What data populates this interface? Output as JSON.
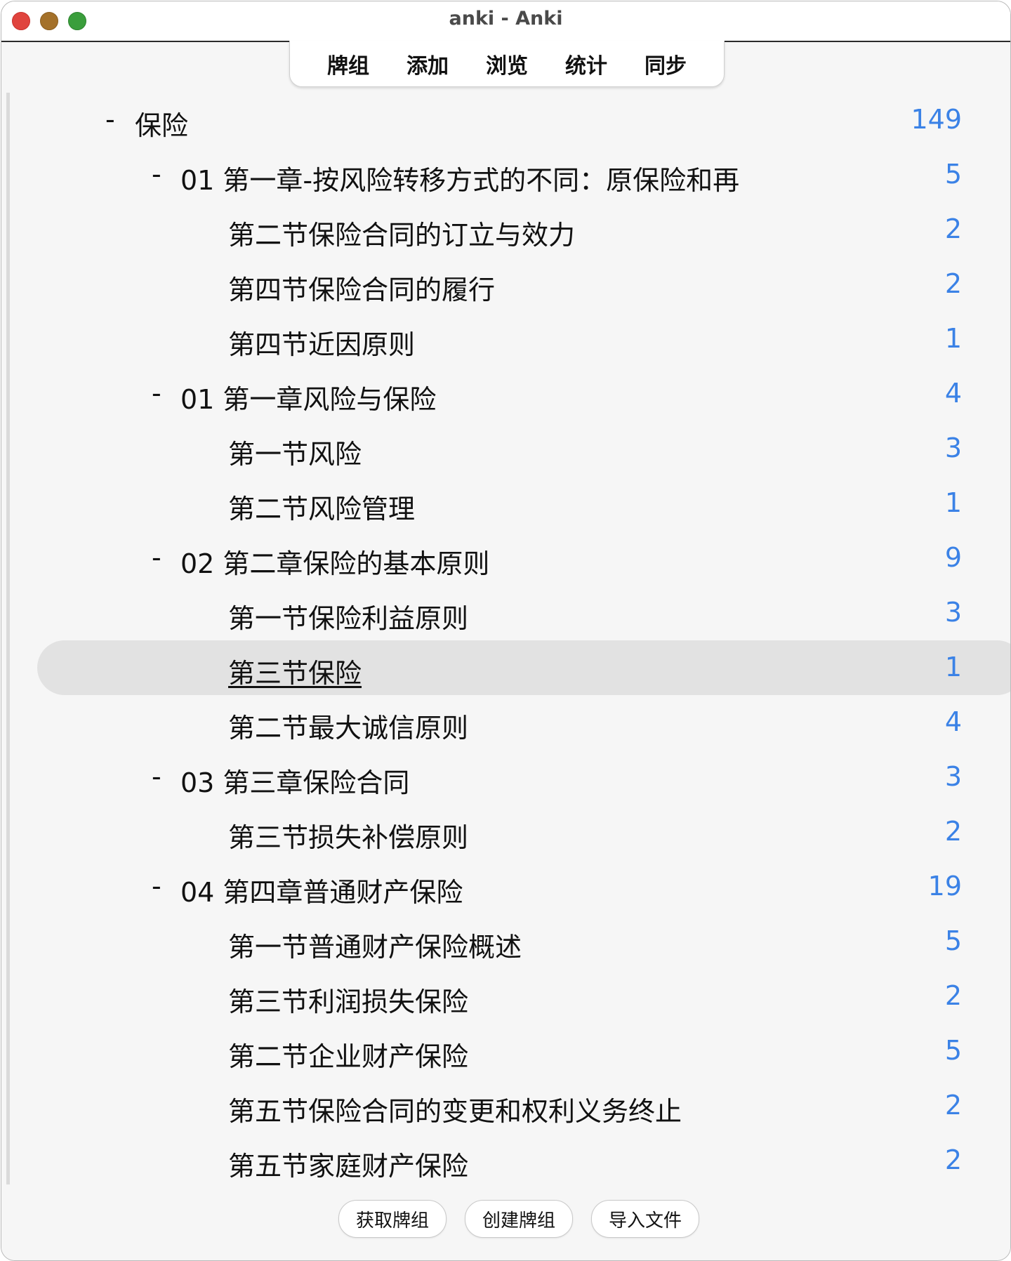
{
  "window": {
    "title": "anki - Anki"
  },
  "toolbar": {
    "tabs": [
      "牌组",
      "添加",
      "浏览",
      "统计",
      "同步"
    ]
  },
  "decks": [
    {
      "name": "保险",
      "count": "149",
      "level": 0,
      "collapse": "-"
    },
    {
      "name": "01 第一章-按风险转移方式的不同：原保险和再",
      "count": "5",
      "level": 1,
      "collapse": "-"
    },
    {
      "name": "第二节保险合同的订立与效力",
      "count": "2",
      "level": 2
    },
    {
      "name": "第四节保险合同的履行",
      "count": "2",
      "level": 2
    },
    {
      "name": "第四节近因原则",
      "count": "1",
      "level": 2
    },
    {
      "name": "01 第一章风险与保险",
      "count": "4",
      "level": 1,
      "collapse": "-"
    },
    {
      "name": "第一节风险",
      "count": "3",
      "level": 2
    },
    {
      "name": "第二节风险管理",
      "count": "1",
      "level": 2
    },
    {
      "name": "02 第二章保险的基本原则",
      "count": "9",
      "level": 1,
      "collapse": "-"
    },
    {
      "name": "第一节保险利益原则",
      "count": "3",
      "level": 2
    },
    {
      "name": "第三节保险",
      "count": "1",
      "level": 2,
      "selected": true
    },
    {
      "name": "第二节最大诚信原则",
      "count": "4",
      "level": 2
    },
    {
      "name": "03 第三章保险合同",
      "count": "3",
      "level": 1,
      "collapse": "-"
    },
    {
      "name": "第三节损失补偿原则",
      "count": "2",
      "level": 2
    },
    {
      "name": "04 第四章普通财产保险",
      "count": "19",
      "level": 1,
      "collapse": "-"
    },
    {
      "name": "第一节普通财产保险概述",
      "count": "5",
      "level": 2
    },
    {
      "name": "第三节利润损失保险",
      "count": "2",
      "level": 2
    },
    {
      "name": "第二节企业财产保险",
      "count": "5",
      "level": 2
    },
    {
      "name": "第五节保险合同的变更和权利义务终止",
      "count": "2",
      "level": 2
    },
    {
      "name": "第五节家庭财产保险",
      "count": "2",
      "level": 2
    }
  ],
  "bottom": {
    "get_shared": "获取牌组",
    "create_deck": "创建牌组",
    "import_file": "导入文件"
  },
  "colors": {
    "count": "#3b82e6",
    "selected_row": "#e2e2e2",
    "close": "#e0443e",
    "minimize": "#a4712a",
    "zoom": "#3a9e3c"
  },
  "icons": {
    "close": "close-icon",
    "minimize": "minimize-icon",
    "zoom": "zoom-icon"
  }
}
